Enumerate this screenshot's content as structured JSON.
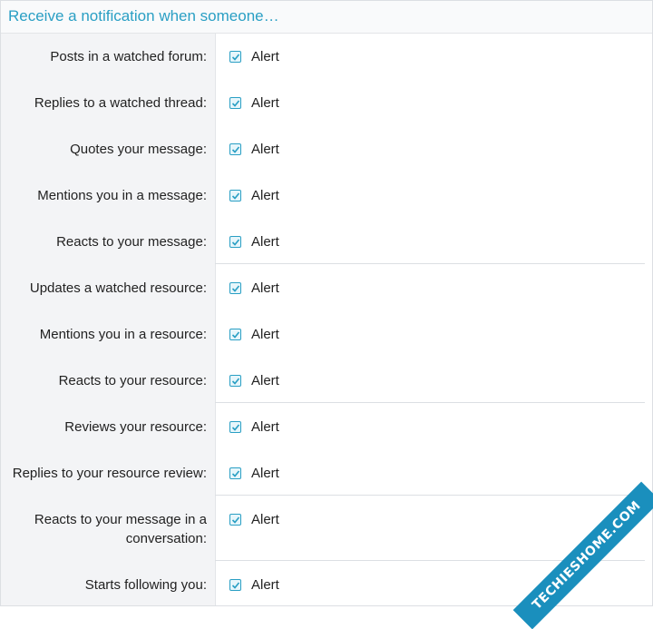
{
  "header": {
    "title": "Receive a notification when someone…"
  },
  "rows": [
    {
      "label": "Posts in a watched forum:",
      "option": "Alert",
      "checked": true
    },
    {
      "label": "Replies to a watched thread:",
      "option": "Alert",
      "checked": true
    },
    {
      "label": "Quotes your message:",
      "option": "Alert",
      "checked": true
    },
    {
      "label": "Mentions you in a message:",
      "option": "Alert",
      "checked": true
    },
    {
      "label": "Reacts to your message:",
      "option": "Alert",
      "checked": true
    },
    {
      "label": "Updates a watched resource:",
      "option": "Alert",
      "checked": true
    },
    {
      "label": "Mentions you in a resource:",
      "option": "Alert",
      "checked": true
    },
    {
      "label": "Reacts to your resource:",
      "option": "Alert",
      "checked": true
    },
    {
      "label": "Reviews your resource:",
      "option": "Alert",
      "checked": true
    },
    {
      "label": "Replies to your resource review:",
      "option": "Alert",
      "checked": true
    },
    {
      "label": "Reacts to your message in a conversation:",
      "option": "Alert",
      "checked": true
    },
    {
      "label": "Starts following you:",
      "option": "Alert",
      "checked": true
    }
  ],
  "watermark": "TECHIESHOME.COM",
  "colors": {
    "accent": "#2a9fc4",
    "label_bg": "#f3f4f6",
    "watermark_bg": "#1a8fbd"
  }
}
